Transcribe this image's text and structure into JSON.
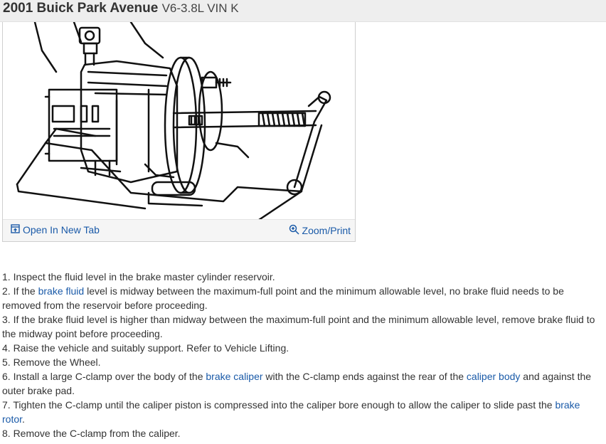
{
  "header": {
    "title": "2001 Buick Park Avenue",
    "subtitle": "V6-3.8L VIN K"
  },
  "figure": {
    "icon": "brake-caliper-c-clamp-diagram",
    "open_label": "Open In New Tab",
    "zoom_label": "Zoom/Print"
  },
  "steps": [
    {
      "parts": [
        {
          "text": "1. Inspect the fluid level in the brake master cylinder reservoir."
        }
      ]
    },
    {
      "parts": [
        {
          "text": "2. If the "
        },
        {
          "text": "brake fluid",
          "link": true
        },
        {
          "text": " level is midway between the maximum-full point and the minimum allowable level, no brake fluid needs to be removed from the reservoir before proceeding."
        }
      ]
    },
    {
      "parts": [
        {
          "text": "3. If the brake fluid level is higher than midway between the maximum-full point and the minimum allowable level, remove brake fluid to the midway point before proceeding."
        }
      ]
    },
    {
      "parts": [
        {
          "text": "4. Raise the vehicle and suitably support. Refer to Vehicle Lifting."
        }
      ]
    },
    {
      "parts": [
        {
          "text": "5. Remove the Wheel."
        }
      ]
    },
    {
      "parts": [
        {
          "text": "6. Install a large C-clamp over the body of the "
        },
        {
          "text": "brake caliper",
          "link": true
        },
        {
          "text": " with the C-clamp ends against the rear of the "
        },
        {
          "text": "caliper body",
          "link": true
        },
        {
          "text": " and against the outer brake pad."
        }
      ]
    },
    {
      "parts": [
        {
          "text": "7. Tighten the C-clamp until the caliper piston is compressed into the caliper bore enough to allow the caliper to slide past the "
        },
        {
          "text": "brake rotor",
          "link": true
        },
        {
          "text": "."
        }
      ]
    },
    {
      "parts": [
        {
          "text": "8. Remove the C-clamp from the caliper."
        }
      ]
    }
  ],
  "colors": {
    "link": "#1a5aa8",
    "text": "#333333",
    "header_bg": "#eeeeee"
  }
}
